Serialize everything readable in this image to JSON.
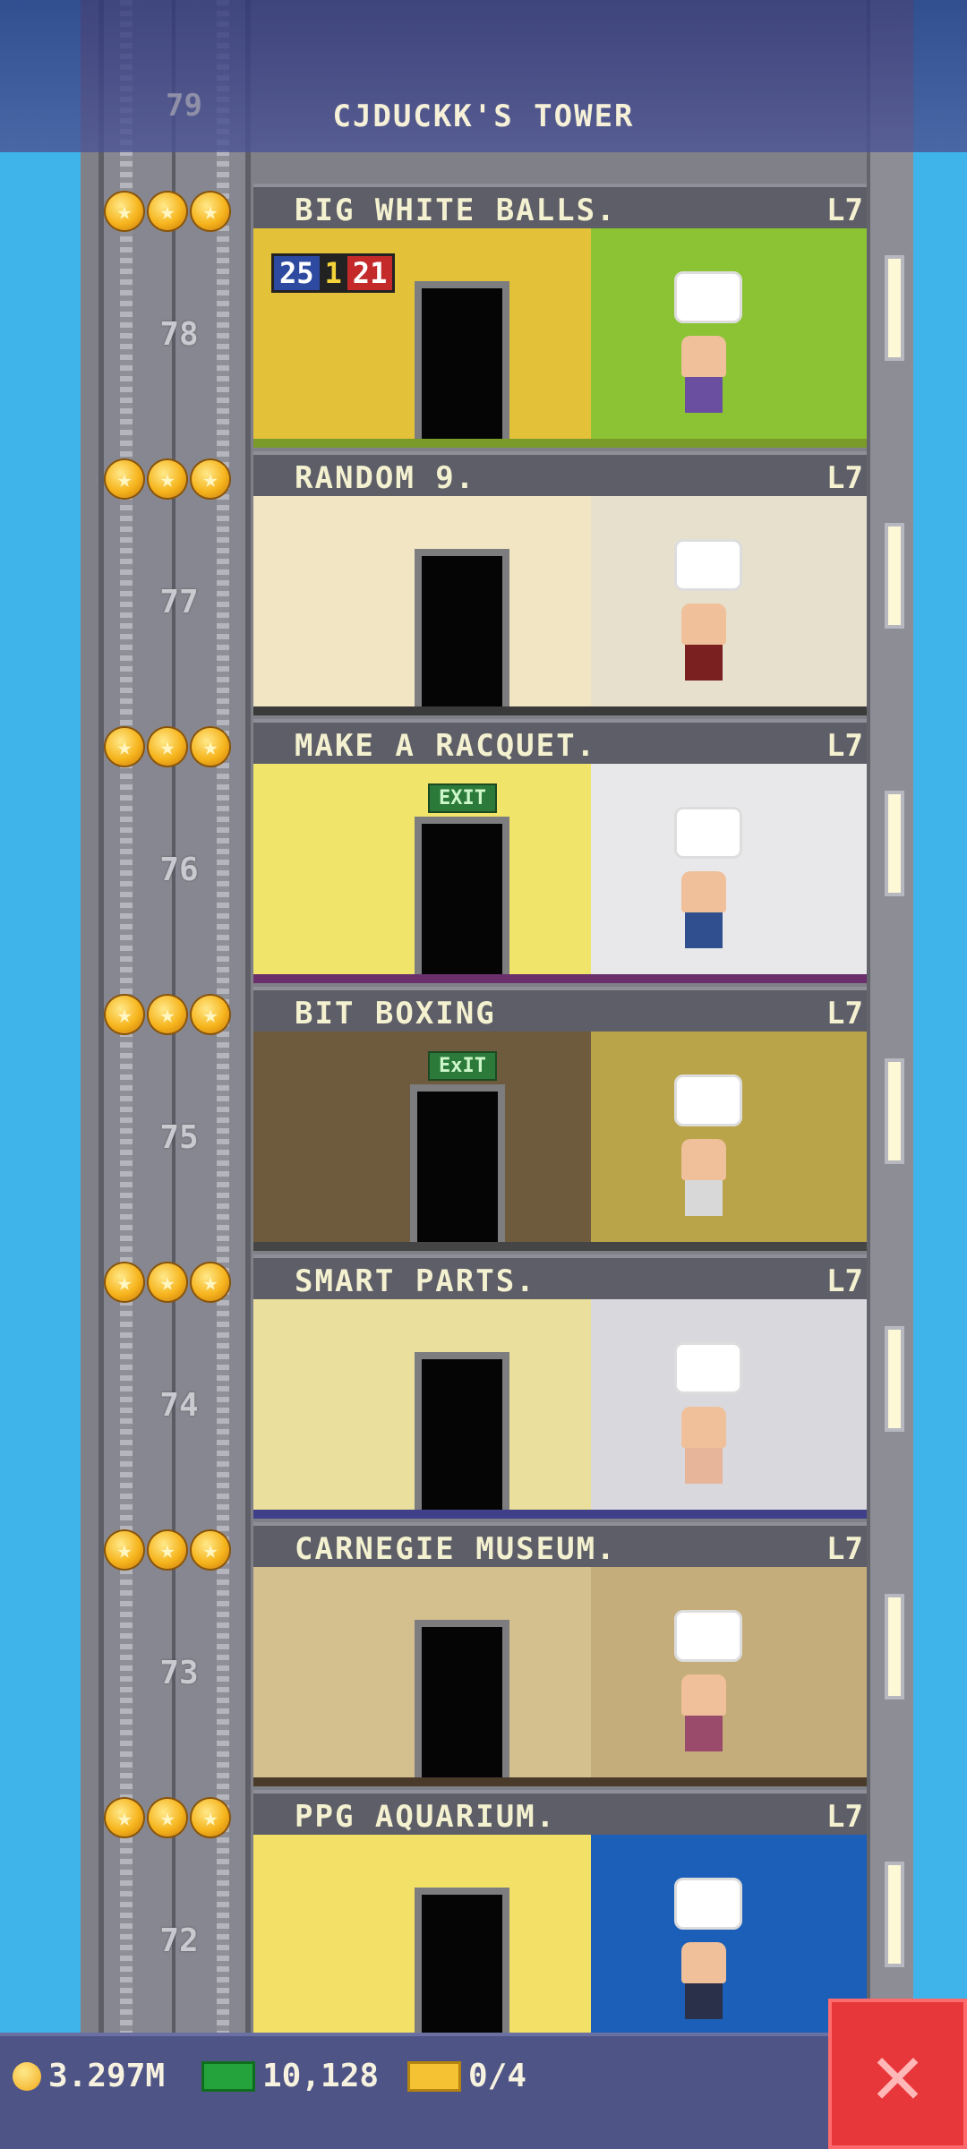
{
  "header": {
    "title": "CJDUCKK'S TOWER",
    "top_floor_number": "79"
  },
  "floors": [
    {
      "name": "BIG WHITE BALLS.",
      "level": "L7",
      "number": "78",
      "scoreboard_left": "25",
      "scoreboard_mid": "1",
      "scoreboard_right": "21",
      "wall_color": "#e3c23a",
      "accent_color": "#8bc334"
    },
    {
      "name": "RANDOM 9.",
      "level": "L7",
      "number": "77",
      "wall_color": "#f1e5c3",
      "accent_color": "#e6e0cc"
    },
    {
      "name": "MAKE A RACQUET.",
      "level": "L7",
      "number": "76",
      "exit_sign": "EXIT",
      "wall_color": "#f0e46a",
      "accent_color": "#e8e8ea"
    },
    {
      "name": "BIT BOXING",
      "level": "L7",
      "number": "75",
      "exit_sign": "ExIT",
      "wall_color": "#6e5a3c",
      "accent_color": "#b9a44a"
    },
    {
      "name": "SMART PARTS.",
      "level": "L7",
      "number": "74",
      "wall_color": "#eadf9c",
      "accent_color": "#d9d9dd"
    },
    {
      "name": "CARNEGIE MUSEUM.",
      "level": "L7",
      "number": "73",
      "wall_color": "#d4bf8e",
      "accent_color": "#c4ad7a"
    },
    {
      "name": "PPG AQUARIUM.",
      "level": "L7",
      "number": "72",
      "wall_color": "#f3e066",
      "accent_color": "#1c5fb8"
    }
  ],
  "stars_per_floor": 3,
  "bottom_bar": {
    "coins": "3.297M",
    "bux": "10,128",
    "tickets": "0/4"
  },
  "icons": {
    "coin": "coin-icon",
    "bux": "bux-icon",
    "ticket": "ticket-icon",
    "close": "close-icon",
    "star": "star-icon"
  },
  "colors": {
    "sky": "#3fb4ea",
    "close_button": "#e8373a",
    "bar": "#4f5486"
  }
}
